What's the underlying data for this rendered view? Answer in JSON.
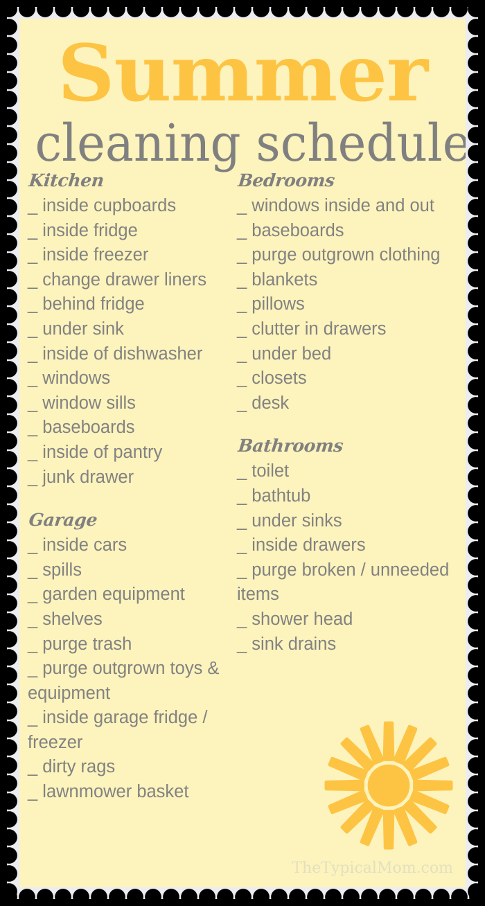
{
  "title": {
    "main": "Summer",
    "sub": "cleaning schedule",
    "main_color": "#fdc444",
    "sub_color": "#808080"
  },
  "card": {
    "background_color": "#fdf3bc",
    "border_color": "#ecedf1",
    "text_color": "#828282"
  },
  "tick_mark": "_",
  "columns": {
    "left": [
      {
        "heading": "Kitchen",
        "items": [
          "inside cupboards",
          "inside fridge",
          "inside freezer",
          "change drawer liners",
          "behind fridge",
          "under sink",
          "inside of dishwasher",
          "windows",
          "window sills",
          "baseboards",
          "inside of pantry",
          "junk drawer"
        ]
      },
      {
        "heading": "Garage",
        "items": [
          "inside cars",
          "spills",
          "garden equipment",
          "shelves",
          "purge trash",
          "purge outgrown toys & equipment",
          "inside garage fridge / freezer",
          "dirty rags",
          "lawnmower basket"
        ]
      }
    ],
    "right": [
      {
        "heading": "Bedrooms",
        "items": [
          "windows inside and out",
          "baseboards",
          "purge outgrown clothing",
          "blankets",
          "pillows",
          "clutter in drawers",
          "under bed",
          "closets",
          "desk"
        ]
      },
      {
        "heading": "Bathrooms",
        "items": [
          "toilet",
          "bathtub",
          "under sinks",
          "inside drawers",
          "purge broken / unneeded items",
          "shower head",
          "sink drains"
        ]
      }
    ]
  },
  "sun": {
    "ray_count": 16,
    "color": "#fdc444"
  },
  "watermark": {
    "text": "TheTypicalMom.com",
    "color": "#e3e0c0"
  }
}
